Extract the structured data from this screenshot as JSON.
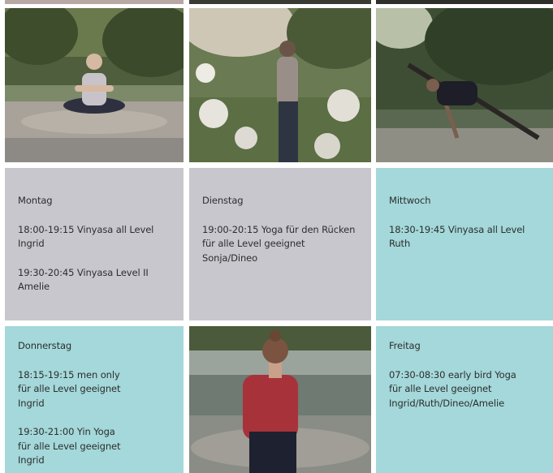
{
  "colors": {
    "grey_card": "#c9c7ce",
    "teal_card": "#a4d8da",
    "text": "#2d2d2d"
  },
  "photos": [
    {
      "name": "yoga-photo-meditation",
      "subject": "person meditating cross-legged on riverbank"
    },
    {
      "name": "yoga-photo-meadow",
      "subject": "person stretching among wild flowers"
    },
    {
      "name": "yoga-photo-side-plank",
      "subject": "person in side angle pose by river"
    },
    {
      "name": "yoga-photo-back-view",
      "subject": "person seen from behind facing river"
    }
  ],
  "schedule": {
    "montag": {
      "day": "Montag",
      "entries": [
        {
          "lines": [
            "18:00-19:15 Vinyasa all Level",
            "Ingrid"
          ]
        },
        {
          "lines": [
            "19:30-20:45 Vinyasa Level II",
            "Amelie"
          ]
        }
      ]
    },
    "dienstag": {
      "day": "Dienstag",
      "entries": [
        {
          "lines": [
            "19:00-20:15 Yoga für den Rücken",
            "für alle Level geeignet",
            "Sonja/Dineo"
          ]
        }
      ]
    },
    "mittwoch": {
      "day": "Mittwoch",
      "entries": [
        {
          "lines": [
            "18:30-19:45 Vinyasa all Level",
            "Ruth"
          ]
        }
      ]
    },
    "donnerstag": {
      "day": "Donnerstag",
      "entries": [
        {
          "lines": [
            "18:15-19:15 men only",
            "für alle Level geeignet",
            "Ingrid"
          ]
        },
        {
          "lines": [
            "19:30-21:00 Yin Yoga",
            "für alle Level geeignet",
            "Ingrid"
          ]
        }
      ]
    },
    "freitag": {
      "day": "Freitag",
      "entries": [
        {
          "lines": [
            "07:30-08:30 early bird Yoga",
            "für alle Level geeignet",
            "Ingrid/Ruth/Dineo/Amelie"
          ]
        }
      ]
    }
  }
}
